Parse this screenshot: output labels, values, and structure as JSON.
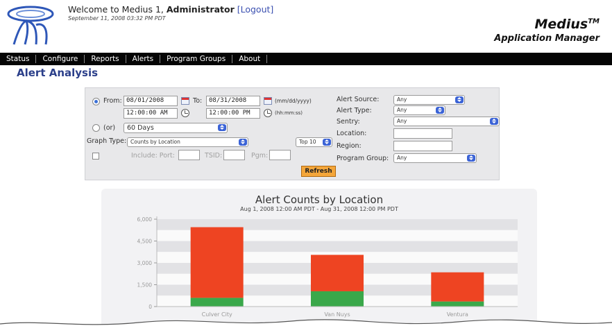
{
  "header": {
    "welcome_prefix": "Welcome to Medius 1, ",
    "user": "Administrator",
    "logout": "[Logout]",
    "datetime": "September 11, 2008 03:32 PM PDT",
    "brand_name": "Medius",
    "brand_tm": "TM",
    "brand_sub": "Application Manager"
  },
  "nav": {
    "items": [
      "Status",
      "Configure",
      "Reports",
      "Alerts",
      "Program Groups",
      "About"
    ]
  },
  "page": {
    "title": "Alert Analysis"
  },
  "filters": {
    "from_label": "From:",
    "from_date": "08/01/2008",
    "from_time": "12:00:00 AM",
    "to_label": "To:",
    "to_date": "08/31/2008",
    "to_time": "12:00:00 PM",
    "date_format": "(mm/dd/yyyy)",
    "time_format": "(hh:mm:ss)",
    "or_label": "(or)",
    "days_value": "60 Days",
    "graph_type_label": "Graph Type:",
    "graph_type_value": "Counts by Location",
    "top_value": "Top 10",
    "include_label": "Include: Port:",
    "tsid_label": "TSID:",
    "pgm_label": "Pgm:",
    "alert_source_label": "Alert Source:",
    "alert_source_value": "Any",
    "alert_type_label": "Alert Type:",
    "alert_type_value": "Any",
    "sentry_label": "Sentry:",
    "sentry_value": "Any",
    "location_label": "Location:",
    "region_label": "Region:",
    "program_group_label": "Program Group:",
    "program_group_value": "Any",
    "refresh_label": "Refresh"
  },
  "chart_data": {
    "type": "bar",
    "title": "Alert Counts by Location",
    "subtitle": "Aug 1, 2008 12:00 AM PDT - Aug 31, 2008 12:00 PM PDT",
    "categories": [
      "Culver City",
      "Van Nuys",
      "Ventura"
    ],
    "stacked": true,
    "series": [
      {
        "color": "#3aa84a",
        "values": [
          600,
          1050,
          350
        ]
      },
      {
        "color": "#ee4422",
        "values": [
          4850,
          2500,
          2000
        ]
      }
    ],
    "yticks": [
      "0",
      "1,500",
      "3,000",
      "4,500",
      "6,000"
    ],
    "ylim": [
      0,
      6000
    ],
    "grid": true
  },
  "colors": {
    "title_blue": "#2b3f8a",
    "nav_bg": "#050505",
    "refresh_orange": "#f4a63a"
  }
}
